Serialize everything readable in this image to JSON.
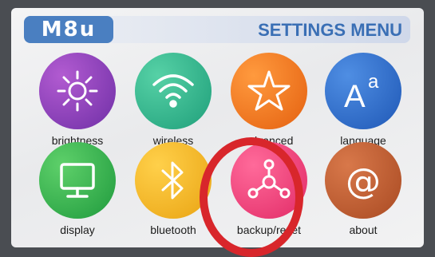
{
  "header": {
    "logo": "M8u",
    "title": "SETTINGS MENU"
  },
  "menu": [
    {
      "label": "brightness",
      "icon": "sun-icon",
      "color": "#8a3fb6"
    },
    {
      "label": "wireless",
      "icon": "wifi-icon",
      "color": "#2fb38c"
    },
    {
      "label": "advanced",
      "icon": "star-icon",
      "color": "#f27a1c"
    },
    {
      "label": "language",
      "icon": "font-size-icon",
      "color": "#2f6fd0"
    },
    {
      "label": "display",
      "icon": "monitor-icon",
      "color": "#2ea84a"
    },
    {
      "label": "bluetooth",
      "icon": "bluetooth-icon",
      "color": "#f0ad1e"
    },
    {
      "label": "backup/reset",
      "icon": "network-hub-icon",
      "color": "#ea3f7a"
    },
    {
      "label": "about",
      "icon": "at-icon",
      "color": "#b8562a"
    }
  ],
  "highlight": {
    "target": "backup/reset",
    "color": "#d8262b"
  }
}
